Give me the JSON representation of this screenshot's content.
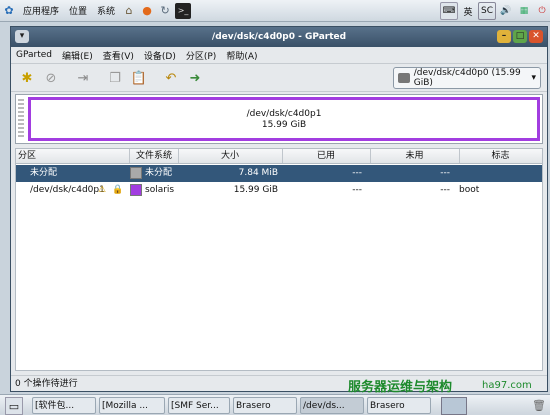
{
  "top_panel": {
    "menus": [
      "应用程序",
      "位置",
      "系统"
    ],
    "icons": [
      "home-icon",
      "firefox-icon",
      "reload-icon",
      "terminal-icon"
    ],
    "tray": {
      "input_lang": "英",
      "sc": "SC",
      "icons": [
        "keyboard-icon",
        "volume-icon",
        "network-icon",
        "power-icon"
      ]
    }
  },
  "window": {
    "title": "/dev/dsk/c4d0p0 - GParted",
    "menu": [
      "GParted",
      "编辑(E)",
      "查看(V)",
      "设备(D)",
      "分区(P)",
      "帮助(A)"
    ],
    "toolbar": {
      "icons": [
        "new-icon",
        "delete-icon",
        "resize-icon",
        "copy-icon",
        "paste-icon",
        "undo-icon",
        "apply-icon"
      ]
    },
    "device_selector": "/dev/dsk/c4d0p0  (15.99 GiB)",
    "map": {
      "partition_name": "/dev/dsk/c4d0p1",
      "partition_size": "15.99 GiB"
    },
    "columns": [
      "分区",
      "文件系统",
      "大小",
      "已用",
      "未用",
      "标志"
    ],
    "rows": [
      {
        "partition": "未分配",
        "filesystem": "未分配",
        "fs_color": "#a9a9a9",
        "size": "7.84 MiB",
        "used": "---",
        "unused": "---",
        "flags": "",
        "selected": true
      },
      {
        "partition": "/dev/dsk/c4d0p1",
        "filesystem": "solaris",
        "fs_color": "#a23de0",
        "size": "15.99 GiB",
        "used": "---",
        "unused": "---",
        "flags": "boot",
        "selected": false
      }
    ],
    "status": "0 个操作待进行"
  },
  "taskbar": {
    "tasks": [
      "[软件包...",
      "[Mozilla ...",
      "[SMF Ser...",
      "Brasero",
      "/dev/ds...",
      "Brasero"
    ]
  },
  "watermark": {
    "text": "服务器运维与架构",
    "url": "ha97.com"
  },
  "colors": {
    "selection": "#33577a",
    "solaris": "#a23de0",
    "unallocated": "#a9a9a9",
    "titlebar": "#3a5168"
  }
}
